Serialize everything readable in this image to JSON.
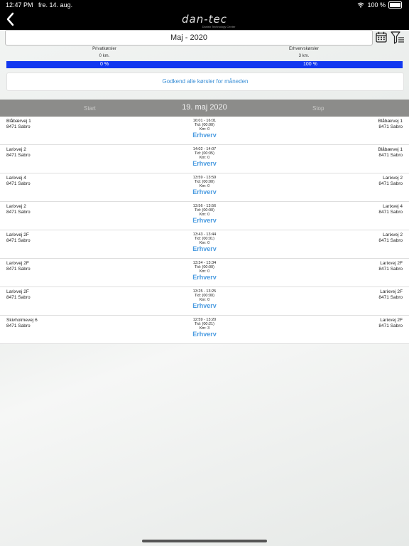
{
  "status": {
    "time": "12:47 PM",
    "date": "fre. 14. aug.",
    "battery": "100 %"
  },
  "header": {
    "logo": "dan-tec",
    "logo_sub": "Danish Technology Center"
  },
  "month": {
    "label": "Maj - 2020"
  },
  "summary": {
    "private_label": "Privatkørsler",
    "private_km": "0  km.",
    "business_label": "Erhvervskørsler",
    "business_km": "3  km.",
    "private_pct_text": "0  %",
    "business_pct_text": "100  %",
    "business_fraction": 1.0,
    "bar_color": "#1238f0"
  },
  "approve_label": "Godkend alle kørsler for måneden",
  "day": {
    "start_label": "Start",
    "date": "19. maj 2020",
    "stop_label": "Stop"
  },
  "trips": [
    {
      "from1": "Blåbærvej 1",
      "from2": "8471 Sabro",
      "times": "16:01  -  16:01",
      "tid": "Tid:  (00:00)",
      "km": "Km:  0",
      "type": "Erhverv",
      "to1": "Blåbærvej 1",
      "to2": "8471 Sabro"
    },
    {
      "from1": "Larixvej 2",
      "from2": "8471 Sabro",
      "times": "14:02  -  14:07",
      "tid": "Tid:  (00:05)",
      "km": "Km:  0",
      "type": "Erhverv",
      "to1": "Blåbærvej 1",
      "to2": "8471 Sabro"
    },
    {
      "from1": "Larixvej 4",
      "from2": "8471 Sabro",
      "times": "13:59  -  13:59",
      "tid": "Tid:  (00:00)",
      "km": "Km:  0",
      "type": "Erhverv",
      "to1": "Larixvej 2",
      "to2": "8471 Sabro"
    },
    {
      "from1": "Larixvej 2",
      "from2": "8471 Sabro",
      "times": "13:56  -  13:56",
      "tid": "Tid:  (00:00)",
      "km": "Km:  0",
      "type": "Erhverv",
      "to1": "Larixvej 4",
      "to2": "8471 Sabro"
    },
    {
      "from1": "Larixvej 2F",
      "from2": "8471 Sabro",
      "times": "13:43  -  13:44",
      "tid": "Tid:  (00:01)",
      "km": "Km:  0",
      "type": "Erhverv",
      "to1": "Larixvej 2",
      "to2": "8471 Sabro"
    },
    {
      "from1": "Larixvej 2F",
      "from2": "8471 Sabro",
      "times": "13:34  -  13:34",
      "tid": "Tid:  (00:00)",
      "km": "Km:  0",
      "type": "Erhverv",
      "to1": "Larixvej 2F",
      "to2": "8471 Sabro"
    },
    {
      "from1": "Larixvej 2F",
      "from2": "8471 Sabro",
      "times": "13:25  -  13:25",
      "tid": "Tid:  (00:00)",
      "km": "Km:  0",
      "type": "Erhverv",
      "to1": "Larixvej 2F",
      "to2": "8471 Sabro"
    },
    {
      "from1": "Skivholmevej 6",
      "from2": "8471 Sabro",
      "times": "12:59  -  13:20",
      "tid": "Tid:  (00:21)",
      "km": "Km:  3",
      "type": "Erhverv",
      "to1": "Larixvej 2F",
      "to2": "8471 Sabro"
    }
  ],
  "icons": {
    "back": "chevron-left-icon",
    "calendar": "calendar-icon",
    "filter": "filter-icon",
    "wifi": "wifi-icon",
    "battery": "battery-icon"
  }
}
